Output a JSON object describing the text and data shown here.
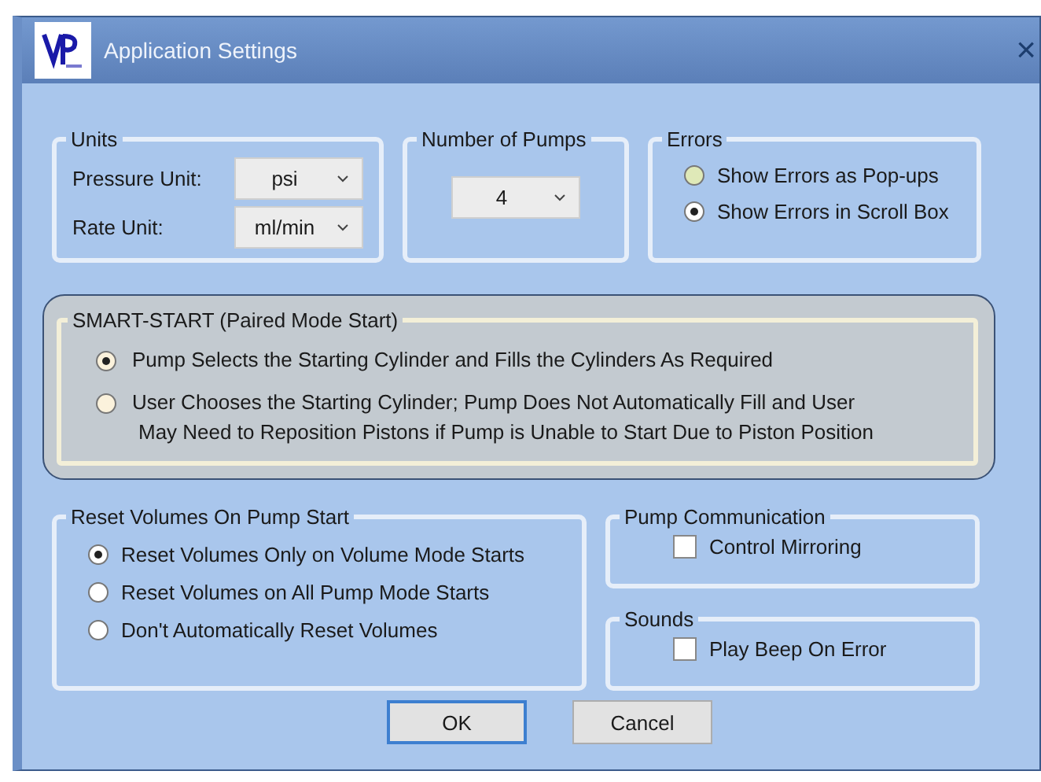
{
  "window": {
    "title": "Application Settings",
    "close": "×"
  },
  "units": {
    "title": "Units",
    "fields": [
      {
        "label": "Pressure Unit:",
        "value": "psi"
      },
      {
        "label": "Rate Unit:",
        "value": "ml/min"
      }
    ]
  },
  "pumps": {
    "title": "Number of Pumps",
    "value": "4"
  },
  "errors": {
    "title": "Errors",
    "options": [
      {
        "label": "Show Errors as Pop-ups",
        "selected": false
      },
      {
        "label": "Show Errors in Scroll Box",
        "selected": true
      }
    ]
  },
  "smart_start": {
    "title": "SMART-START (Paired Mode Start)",
    "options": [
      {
        "lines": [
          "Pump Selects the Starting Cylinder and Fills the Cylinders As Required"
        ],
        "selected": true
      },
      {
        "lines": [
          "User Chooses the Starting Cylinder; Pump Does Not Automatically Fill and User",
          "May Need to Reposition Pistons if Pump is Unable to Start Due to Piston Position"
        ],
        "selected": false
      }
    ]
  },
  "reset": {
    "title": "Reset Volumes On Pump Start",
    "options": [
      {
        "label": "Reset Volumes Only on Volume Mode Starts",
        "selected": true
      },
      {
        "label": "Reset Volumes on All Pump Mode Starts",
        "selected": false
      },
      {
        "label": "Don't Automatically Reset Volumes",
        "selected": false
      }
    ]
  },
  "pump_communication": {
    "title": "Pump Communication",
    "checkbox": {
      "label": "Control Mirroring",
      "checked": false
    }
  },
  "sounds": {
    "title": "Sounds",
    "checkbox": {
      "label": "Play Beep On Error",
      "checked": false
    }
  },
  "buttons": [
    {
      "label": "OK",
      "default": true
    },
    {
      "label": "Cancel",
      "default": false
    }
  ]
}
